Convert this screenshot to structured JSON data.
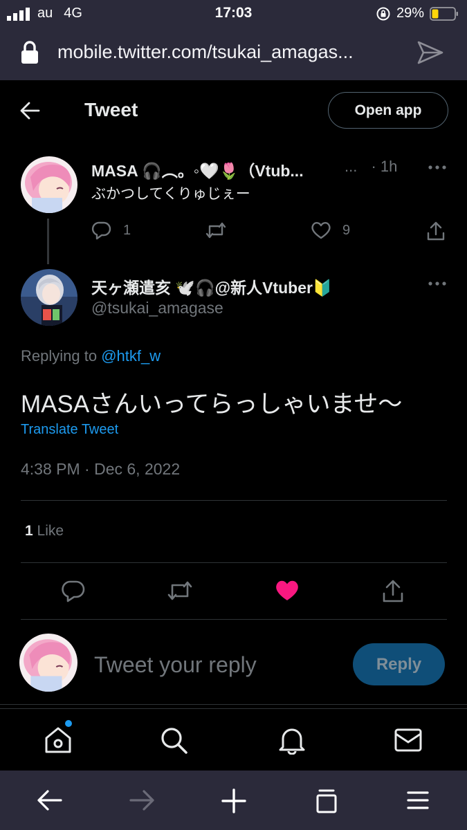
{
  "status_bar": {
    "carrier": "au",
    "network": "4G",
    "time": "17:03",
    "battery_percent": "29%",
    "battery_level": 0.29
  },
  "browser": {
    "url": "mobile.twitter.com/tsukai_amagas..."
  },
  "header": {
    "title": "Tweet",
    "open_app": "Open app"
  },
  "parent_tweet": {
    "name": "MASA 🎧︵。◦🤍🌷（Vtub...",
    "name_ellipsis": "...",
    "meta": "· 1h",
    "text": "ぶかつしてくりゅじぇー",
    "replies": "1",
    "retweets": "",
    "likes": "9"
  },
  "main_tweet": {
    "name": "天ヶ瀬遣亥 🕊️🎧@新人Vtuber🔰",
    "handle": "@tsukai_amagase",
    "replying_prefix": "Replying to ",
    "replying_to": "@htkf_w",
    "text": "MASAさんいってらっしゃいませ〜",
    "translate": "Translate Tweet",
    "timestamp": "4:38 PM · Dec 6, 2022",
    "like_count": "1",
    "like_label": " Like"
  },
  "reply_box": {
    "placeholder": "Tweet your reply",
    "button": "Reply"
  },
  "colors": {
    "accent": "#1d9bf0",
    "like": "#f91880",
    "muted": "#71767b",
    "chrome": "#2b2a3a"
  },
  "icons": {
    "nav": [
      "home-icon",
      "search-icon",
      "bell-icon",
      "mail-icon"
    ],
    "browser": [
      "back-arrow-icon",
      "forward-arrow-icon",
      "plus-icon",
      "tabs-icon",
      "menu-icon"
    ]
  }
}
